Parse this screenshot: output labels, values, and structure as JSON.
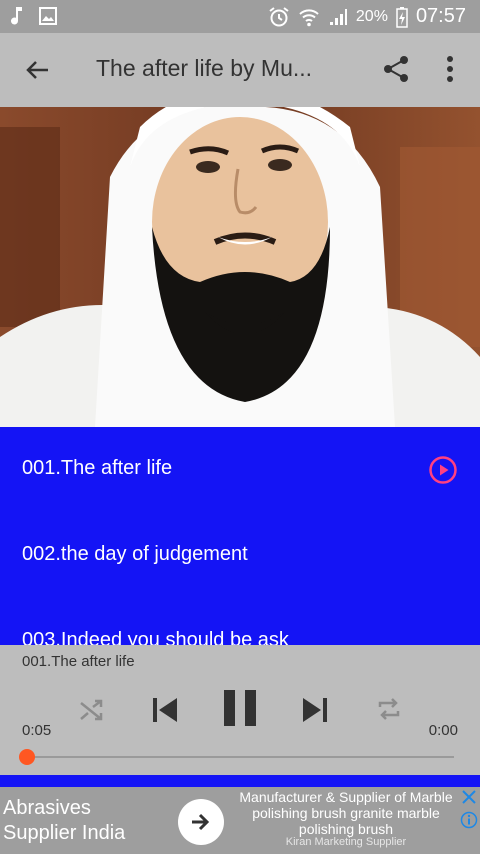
{
  "status_bar": {
    "battery": "20%",
    "time": "07:57"
  },
  "app_bar": {
    "title": "The after life by Mu..."
  },
  "tracks": [
    {
      "label": "001.The after life"
    },
    {
      "label": "002.the day of judgement"
    },
    {
      "label": "003.Indeed you should be ask"
    }
  ],
  "player": {
    "now_playing": "001.The after life",
    "current_time": "0:05",
    "total_time": "0:00",
    "progress": 0
  },
  "ad": {
    "left_text_line1": "Abrasives",
    "left_text_line2": "Supplier India",
    "description": "Manufacturer & Supplier of Marble polishing brush granite marble polishing brush",
    "advertiser": "Kiran Marketing Supplier"
  },
  "colors": {
    "list_background": "#1414f5",
    "accent": "#ff5722",
    "toolbar": "#bdbdbd"
  }
}
